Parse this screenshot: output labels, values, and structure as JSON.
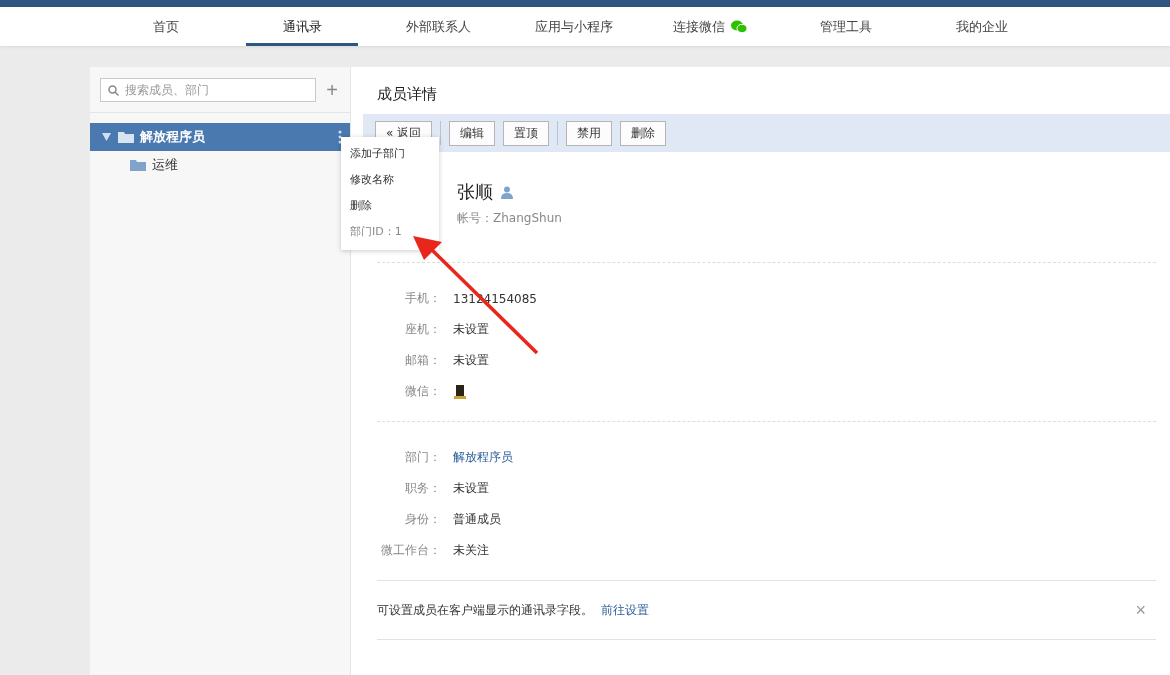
{
  "nav": [
    {
      "label": "首页",
      "selected": false,
      "wechat": false
    },
    {
      "label": "通讯录",
      "selected": true,
      "wechat": false
    },
    {
      "label": "外部联系人",
      "selected": false,
      "wechat": false
    },
    {
      "label": "应用与小程序",
      "selected": false,
      "wechat": false
    },
    {
      "label": "连接微信",
      "selected": false,
      "wechat": true
    },
    {
      "label": "管理工具",
      "selected": false,
      "wechat": false
    },
    {
      "label": "我的企业",
      "selected": false,
      "wechat": false
    }
  ],
  "search": {
    "placeholder": "搜索成员、部门"
  },
  "add_button": "+",
  "tree": [
    {
      "label": "解放程序员",
      "selected": true,
      "expanded": true,
      "children": [
        {
          "label": "运维",
          "selected": false
        }
      ]
    }
  ],
  "context_menu": {
    "items": [
      "添加子部门",
      "修改名称",
      "删除"
    ],
    "info": "部门ID：1"
  },
  "detail": {
    "title": "成员详情",
    "toolbar": [
      {
        "label": "« 返回",
        "separator_before": false
      },
      {
        "label": "编辑",
        "separator_before": true
      },
      {
        "label": "置顶",
        "separator_before": false
      },
      {
        "label": "禁用",
        "separator_before": true
      },
      {
        "label": "删除",
        "separator_before": false
      }
    ],
    "name": "张顺",
    "account": "帐号：ZhangShun",
    "contact_fields": [
      {
        "label": "手机：",
        "value": "13124154085",
        "kind": "text"
      },
      {
        "label": "座机：",
        "value": "未设置",
        "kind": "text"
      },
      {
        "label": "邮箱：",
        "value": "未设置",
        "kind": "text"
      },
      {
        "label": "微信：",
        "kind": "wechat-avatar"
      }
    ],
    "org_fields": [
      {
        "label": "部门：",
        "value": "解放程序员",
        "kind": "link"
      },
      {
        "label": "职务：",
        "value": "未设置",
        "kind": "text"
      },
      {
        "label": "身份：",
        "value": "普通成员",
        "kind": "text"
      },
      {
        "label": "微工作台：",
        "value": "未关注",
        "kind": "text"
      }
    ],
    "notice": {
      "text": "可设置成员在客户端显示的通讯录字段。",
      "link": "前往设置",
      "close": "×"
    }
  }
}
